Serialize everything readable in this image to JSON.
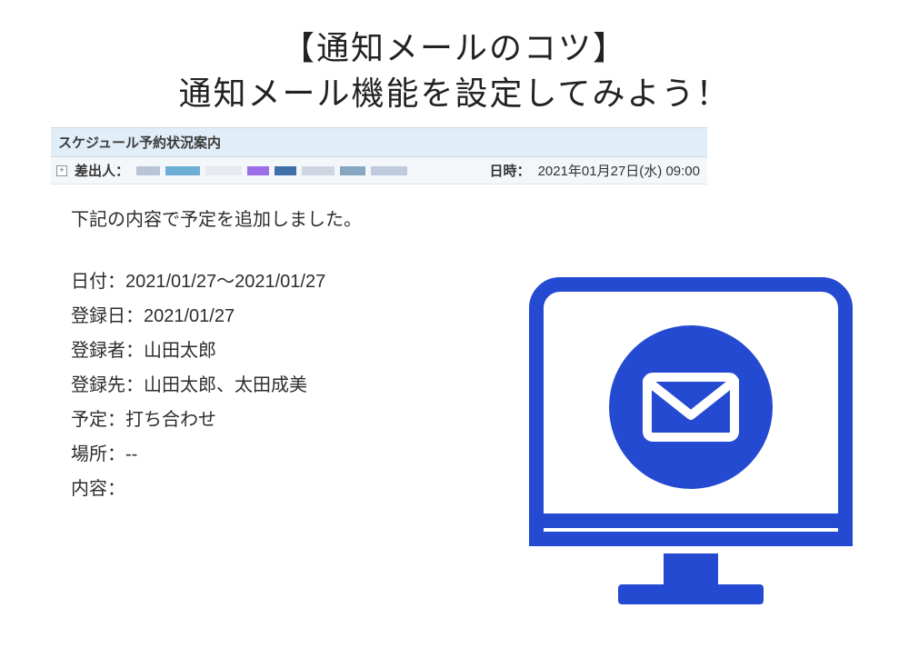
{
  "heading": {
    "line1": "【通知メールのコツ】",
    "line2": "通知メール機能を設定してみよう！"
  },
  "email": {
    "title": "スケジュール予約状況案内",
    "sender_label": "差出人：",
    "datetime_label": "日時：",
    "datetime_value": "2021年01月27日(水) 09:00",
    "body_intro": "下記の内容で予定を追加しました。",
    "lines": {
      "l1": "日付：2021/01/27〜2021/01/27",
      "l2": "登録日：2021/01/27",
      "l3": "登録者：山田太郎",
      "l4": "登録先：山田太郎、太田成美",
      "l5": "予定：打ち合わせ",
      "l6": "場所：--",
      "l7": "内容："
    }
  },
  "icons": {
    "monitor": "monitor-mail-icon"
  }
}
